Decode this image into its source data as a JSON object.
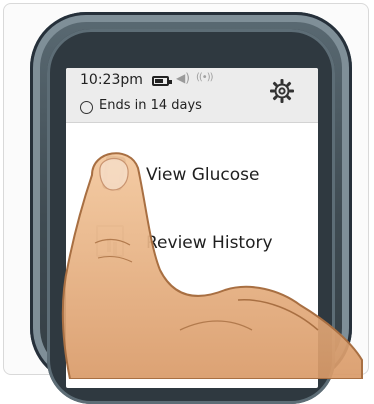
{
  "status": {
    "time": "10:23pm",
    "sensor_label": "Ends in 14 days"
  },
  "menu": {
    "items": [
      {
        "label": "View Glucose",
        "icon": "phone-icon"
      },
      {
        "label": "Review History",
        "icon": "document-chart-icon"
      }
    ]
  },
  "icons": {
    "battery": "battery-icon",
    "sound": "speaker-icon",
    "wireless": "wireless-icon",
    "settings": "gear-icon",
    "timer": "timer-icon"
  }
}
